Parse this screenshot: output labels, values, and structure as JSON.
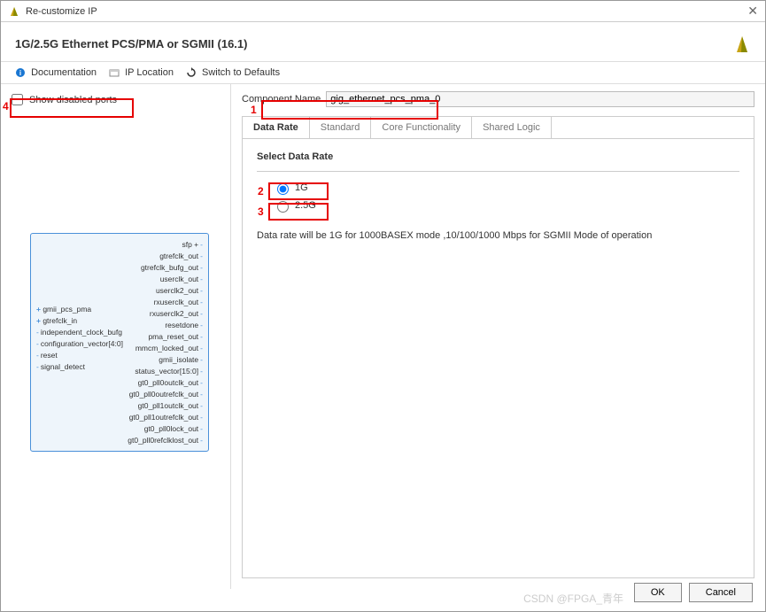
{
  "window": {
    "title": "Re-customize IP"
  },
  "header": {
    "title": "1G/2.5G Ethernet PCS/PMA or SGMII (16.1)"
  },
  "toolbar": {
    "documentation": "Documentation",
    "ip_location": "IP Location",
    "switch_defaults": "Switch to Defaults"
  },
  "left": {
    "show_disabled": "Show disabled ports",
    "ports_left": [
      {
        "label": "gmii_pcs_pma",
        "plus": true
      },
      {
        "label": "gtrefclk_in",
        "plus": true
      },
      {
        "label": "independent_clock_bufg"
      },
      {
        "label": "configuration_vector[4:0]"
      },
      {
        "label": "reset"
      },
      {
        "label": "signal_detect"
      }
    ],
    "ports_right": [
      {
        "label": "sfp",
        "plus": true
      },
      {
        "label": "gtrefclk_out"
      },
      {
        "label": "gtrefclk_bufg_out"
      },
      {
        "label": "userclk_out"
      },
      {
        "label": "userclk2_out"
      },
      {
        "label": "rxuserclk_out"
      },
      {
        "label": "rxuserclk2_out"
      },
      {
        "label": "resetdone"
      },
      {
        "label": "pma_reset_out"
      },
      {
        "label": "mmcm_locked_out"
      },
      {
        "label": "gmii_isolate"
      },
      {
        "label": "status_vector[15:0]"
      },
      {
        "label": "gt0_pll0outclk_out"
      },
      {
        "label": "gt0_pll0outrefclk_out"
      },
      {
        "label": "gt0_pll1outclk_out"
      },
      {
        "label": "gt0_pll1outrefclk_out"
      },
      {
        "label": "gt0_pll0lock_out"
      },
      {
        "label": "gt0_pll0refclklost_out"
      }
    ]
  },
  "right": {
    "component_name_label": "Component Name",
    "component_name_value": "gig_ethernet_pcs_pma_0",
    "tabs": [
      "Data Rate",
      "Standard",
      "Core Functionality",
      "Shared Logic"
    ],
    "active_tab": 0,
    "section_label": "Select Data Rate",
    "rate_1g": "1G",
    "rate_25g": "2.5G",
    "hint": "Data rate will be 1G for 1000BASEX mode ,10/100/1000 Mbps for SGMII Mode of operation"
  },
  "buttons": {
    "ok": "OK",
    "cancel": "Cancel"
  },
  "watermark": "CSDN @FPGA_青年",
  "annotations": {
    "a1": "1",
    "a2": "2",
    "a3": "3",
    "a4": "4"
  }
}
